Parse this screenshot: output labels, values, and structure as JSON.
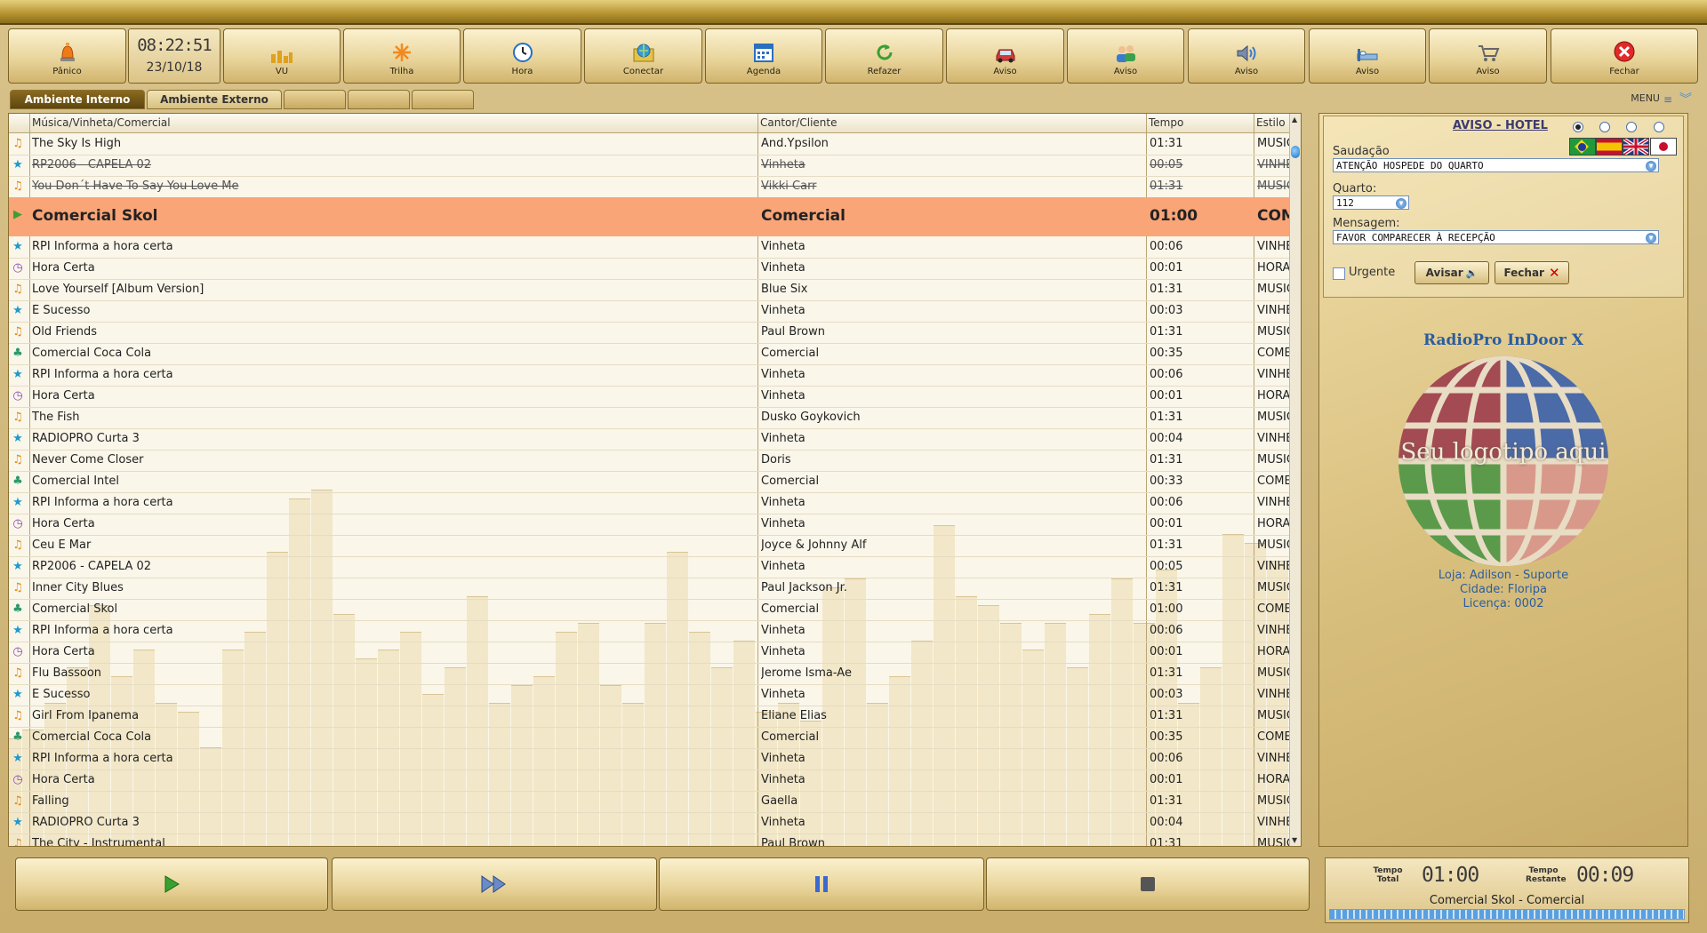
{
  "toolbar": {
    "panic": "Pânico",
    "clock_time": "08:22:51",
    "clock_date": "23/10/18",
    "vu": "VU",
    "trilha": "Trilha",
    "hora": "Hora",
    "conectar": "Conectar",
    "agenda": "Agenda",
    "refazer": "Refazer",
    "aviso1": "Aviso",
    "aviso2": "Aviso",
    "aviso3": "Aviso",
    "aviso4": "Aviso",
    "aviso5": "Aviso",
    "fechar": "Fechar"
  },
  "tabs": {
    "interno": "Ambiente Interno",
    "externo": "Ambiente Externo",
    "menu": "MENU"
  },
  "playlist": {
    "headers": {
      "title": "Música/Vinheta/Comercial",
      "artist": "Cantor/Cliente",
      "time": "Tempo",
      "style": "Estilo"
    },
    "rows": [
      {
        "type": "music",
        "title": "The Sky Is High",
        "artist": "And.Ypsilon",
        "time": "01:31",
        "style": "MUSICA"
      },
      {
        "type": "vinheta",
        "title": "RP2006 - CAPELA 02",
        "artist": "Vinheta",
        "time": "00:05",
        "style": "VINHETA"
      },
      {
        "type": "music",
        "title": "You Don´t Have To Say You Love Me",
        "artist": "Vikki Carr",
        "time": "01:31",
        "style": "MUSICA"
      },
      {
        "type": "play",
        "title": "Comercial Skol",
        "artist": "Comercial",
        "time": "01:00",
        "style": "COMERCIAL"
      },
      {
        "type": "vinheta",
        "title": "RPI Informa a hora certa",
        "artist": "Vinheta",
        "time": "00:06",
        "style": "VINHETA"
      },
      {
        "type": "hora",
        "title": "Hora Certa",
        "artist": "Vinheta",
        "time": "00:01",
        "style": "HORAS"
      },
      {
        "type": "music",
        "title": "Love Yourself [Album Version]",
        "artist": "Blue Six",
        "time": "01:31",
        "style": "MUSICA"
      },
      {
        "type": "vinheta",
        "title": "É Sucesso",
        "artist": "Vinheta",
        "time": "00:03",
        "style": "VINHETA"
      },
      {
        "type": "music",
        "title": "Old Friends",
        "artist": "Paul Brown",
        "time": "01:31",
        "style": "MUSICA"
      },
      {
        "type": "comercial",
        "title": "Comercial Coca Cola",
        "artist": "Comercial",
        "time": "00:35",
        "style": "COMERCIAL"
      },
      {
        "type": "vinheta",
        "title": "RPI Informa a hora certa",
        "artist": "Vinheta",
        "time": "00:06",
        "style": "VINHETA"
      },
      {
        "type": "hora",
        "title": "Hora Certa",
        "artist": "Vinheta",
        "time": "00:01",
        "style": "HORAS"
      },
      {
        "type": "music",
        "title": "The Fish",
        "artist": "Dusko Goykovich",
        "time": "01:31",
        "style": "MUSICA"
      },
      {
        "type": "vinheta",
        "title": "RADIOPRO Curta 3",
        "artist": "Vinheta",
        "time": "00:04",
        "style": "VINHETA"
      },
      {
        "type": "music",
        "title": "Never Come Closer",
        "artist": "Doris",
        "time": "01:31",
        "style": "MUSICA"
      },
      {
        "type": "comercial",
        "title": "Comercial Intel",
        "artist": "Comercial",
        "time": "00:33",
        "style": "COMERCIAL"
      },
      {
        "type": "vinheta",
        "title": "RPI Informa a hora certa",
        "artist": "Vinheta",
        "time": "00:06",
        "style": "VINHETA"
      },
      {
        "type": "hora",
        "title": "Hora Certa",
        "artist": "Vinheta",
        "time": "00:01",
        "style": "HORAS"
      },
      {
        "type": "music",
        "title": "Ceu E Mar",
        "artist": "Joyce & Johnny Alf",
        "time": "01:31",
        "style": "MUSICA"
      },
      {
        "type": "vinheta",
        "title": "RP2006 - CAPELA 02",
        "artist": "Vinheta",
        "time": "00:05",
        "style": "VINHETA"
      },
      {
        "type": "music",
        "title": "Inner City Blues",
        "artist": "Paul Jackson Jr.",
        "time": "01:31",
        "style": "MUSICA"
      },
      {
        "type": "comercial",
        "title": "Comercial Skol",
        "artist": "Comercial",
        "time": "01:00",
        "style": "COMERCIAL"
      },
      {
        "type": "vinheta",
        "title": "RPI Informa a hora certa",
        "artist": "Vinheta",
        "time": "00:06",
        "style": "VINHETA"
      },
      {
        "type": "hora",
        "title": "Hora Certa",
        "artist": "Vinheta",
        "time": "00:01",
        "style": "HORAS"
      },
      {
        "type": "music",
        "title": "Flu Bassoon",
        "artist": "Jerome Isma-Ae",
        "time": "01:31",
        "style": "MUSICA"
      },
      {
        "type": "vinheta",
        "title": "É Sucesso",
        "artist": "Vinheta",
        "time": "00:03",
        "style": "VINHETA"
      },
      {
        "type": "music",
        "title": "Girl From Ipanema",
        "artist": "Eliane Elias",
        "time": "01:31",
        "style": "MUSICA"
      },
      {
        "type": "comercial",
        "title": "Comercial Coca Cola",
        "artist": "Comercial",
        "time": "00:35",
        "style": "COMERCIAL"
      },
      {
        "type": "vinheta",
        "title": "RPI Informa a hora certa",
        "artist": "Vinheta",
        "time": "00:06",
        "style": "VINHETA"
      },
      {
        "type": "hora",
        "title": "Hora Certa",
        "artist": "Vinheta",
        "time": "00:01",
        "style": "HORAS"
      },
      {
        "type": "music",
        "title": "Falling",
        "artist": "Gaella",
        "time": "01:31",
        "style": "MUSICA"
      },
      {
        "type": "vinheta",
        "title": "RADIOPRO Curta 3",
        "artist": "Vinheta",
        "time": "00:04",
        "style": "VINHETA"
      },
      {
        "type": "music",
        "title": "The City - Instrumental",
        "artist": "Paul Brown",
        "time": "01:31",
        "style": "MUSICA"
      }
    ]
  },
  "aviso": {
    "title": "AVISO - HOTEL",
    "saudacao_label": "Saudação",
    "saudacao_value": "ATENÇÃO HOSPEDE DO QUARTO",
    "quarto_label": "Quarto:",
    "quarto_value": "112",
    "mensagem_label": "Mensagem:",
    "mensagem_value": "FAVOR COMPARECER À RECEPÇÃO",
    "urgente": "Urgente",
    "avisar_btn": "Avisar",
    "fechar_btn": "Fechar"
  },
  "logo": {
    "title": "RadioPro InDoor X",
    "placeholder": "Seu logotipo aqui",
    "loja": "Loja: Adilson - Suporte",
    "cidade": "Cidade: Floripa",
    "licenca": "Licença: 0002"
  },
  "status": {
    "tempo_total_label": "Tempo Total",
    "tempo_total": "01:00",
    "tempo_restante_label": "Tempo Restante",
    "tempo_restante": "00:09",
    "now_playing": "Comercial Skol - Comercial"
  },
  "colors": {
    "accent": "#f9a578",
    "brand_blue": "#2a5d9f",
    "gold": "#d8bf80"
  }
}
